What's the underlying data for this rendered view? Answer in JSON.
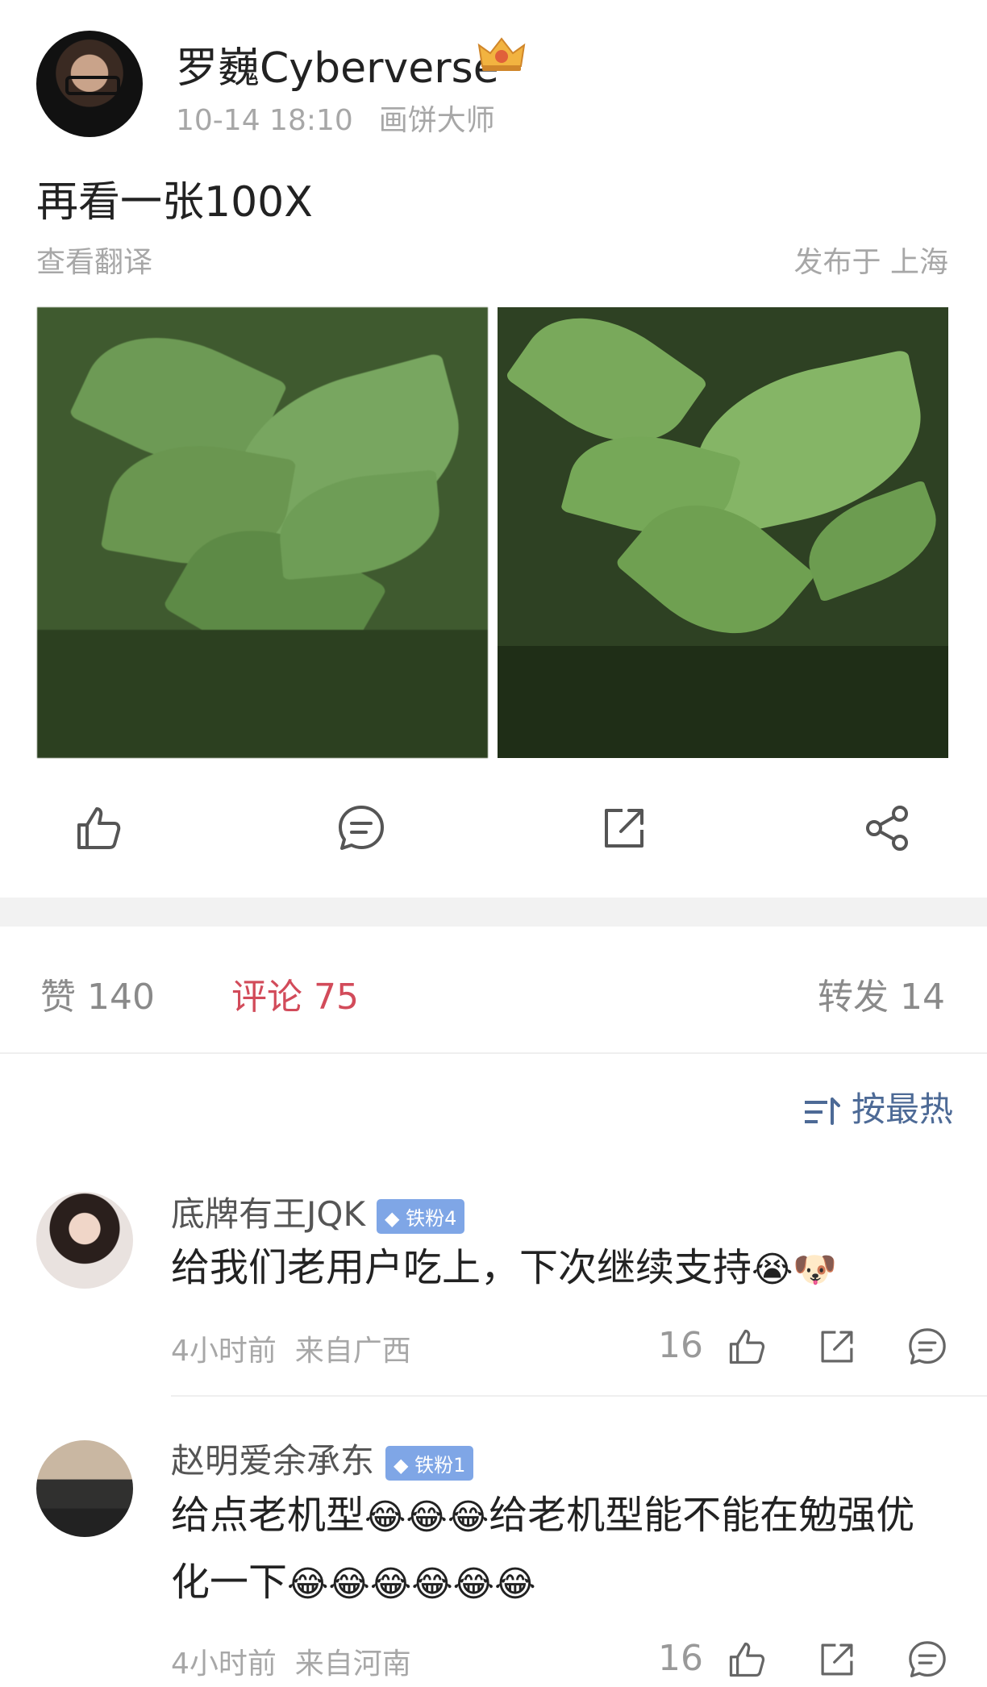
{
  "post": {
    "author": "罗巍Cyberverse",
    "time": "10-14 18:10",
    "source": "画饼大师",
    "text": "再看一张100X",
    "translate_label": "查看翻译",
    "location": "发布于 上海"
  },
  "actions": {
    "like_icon": "thumbs-up-icon",
    "comment_icon": "comment-icon",
    "repost_icon": "repost-icon",
    "share_icon": "share-icon"
  },
  "tabs": {
    "likes": "赞 140",
    "comments": "评论 75",
    "reposts": "转发 14",
    "active_color": "#d24b5a"
  },
  "sort": {
    "label": "按最热"
  },
  "comments": [
    {
      "name": "底牌有王JQK",
      "badge": "铁粉4",
      "text": "给我们老用户吃上，下次继续支持",
      "emojis": "😭🐶",
      "time": "4小时前",
      "from": "来自广西",
      "likes": "16"
    },
    {
      "name": "赵明爱余承东",
      "badge": "铁粉1",
      "text_part1": "给点老机型",
      "emojis_1": "😂😂😂",
      "text_part2": "给老机型能不能在勉强优化一下",
      "emojis_2": "😂😂😂😂😂😂",
      "time": "4小时前",
      "from": "来自河南",
      "likes": "16"
    }
  ]
}
